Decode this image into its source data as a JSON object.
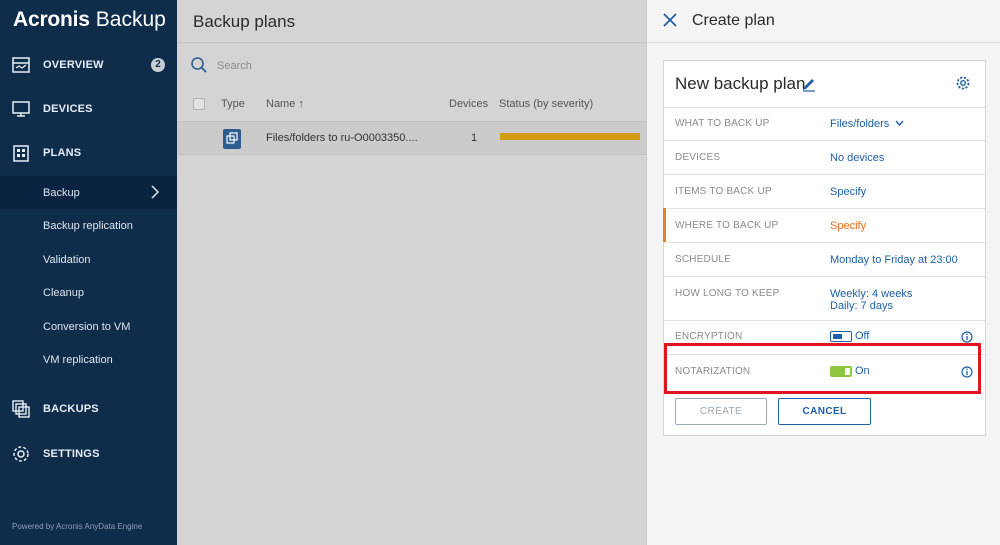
{
  "sidebar": {
    "logo_brand": "Acronis",
    "logo_product": "Backup",
    "items": [
      {
        "label": "OVERVIEW",
        "icon": "overview-icon",
        "badge": "2"
      },
      {
        "label": "DEVICES",
        "icon": "devices-icon"
      },
      {
        "label": "PLANS",
        "icon": "plans-icon"
      },
      {
        "label": "BACKUPS",
        "icon": "backups-icon"
      },
      {
        "label": "SETTINGS",
        "icon": "settings-icon"
      }
    ],
    "plan_subitems": [
      {
        "label": "Backup",
        "active": true
      },
      {
        "label": "Backup replication"
      },
      {
        "label": "Validation"
      },
      {
        "label": "Cleanup"
      },
      {
        "label": "Conversion to VM"
      },
      {
        "label": "VM replication"
      }
    ],
    "footer": "Powered by Acronis AnyData Engine"
  },
  "main": {
    "title": "Backup plans",
    "search_placeholder": "Search",
    "columns": {
      "type": "Type",
      "name": "Name ↑",
      "devices": "Devices",
      "status": "Status (by severity)"
    },
    "rows": [
      {
        "name": "Files/folders to ru-O0003350....",
        "devices": "1",
        "status_color": "#d49a10"
      }
    ]
  },
  "panel": {
    "title": "Create plan",
    "plan_name": "New backup plan",
    "rows": {
      "what": {
        "label": "WHAT TO BACK UP",
        "value": "Files/folders"
      },
      "devices": {
        "label": "DEVICES",
        "value": "No devices"
      },
      "items": {
        "label": "ITEMS TO BACK UP",
        "value": "Specify"
      },
      "where": {
        "label": "WHERE TO BACK UP",
        "value": "Specify"
      },
      "schedule": {
        "label": "SCHEDULE",
        "value": "Monday to Friday at 23:00"
      },
      "retention": {
        "label": "HOW LONG TO KEEP",
        "value_line1": "Weekly: 4 weeks",
        "value_line2": "Daily: 7 days"
      },
      "encryption": {
        "label": "ENCRYPTION",
        "value": "Off"
      },
      "notarization": {
        "label": "NOTARIZATION",
        "value": "On"
      }
    },
    "create_label": "CREATE",
    "cancel_label": "CANCEL"
  },
  "colors": {
    "sidebar_bg": "#0f2c4a",
    "accent_blue": "#1f5fa5",
    "warning_orange": "#e86b1a",
    "toggle_on": "#8ec63f",
    "highlight_red": "#e0141e"
  }
}
